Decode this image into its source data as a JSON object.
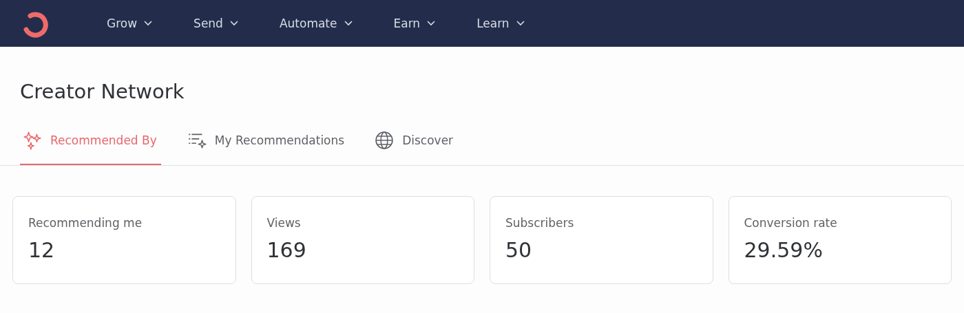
{
  "nav": {
    "items": [
      {
        "label": "Grow"
      },
      {
        "label": "Send"
      },
      {
        "label": "Automate"
      },
      {
        "label": "Earn"
      },
      {
        "label": "Learn"
      }
    ]
  },
  "page_title": "Creator Network",
  "tabs": [
    {
      "label": "Recommended By",
      "kind": "sparkles",
      "selected": true
    },
    {
      "label": "My Recommendations",
      "kind": "list",
      "selected": false
    },
    {
      "label": "Discover",
      "kind": "globe",
      "selected": false
    }
  ],
  "stats": [
    {
      "label": "Recommending me",
      "value": "12"
    },
    {
      "label": "Views",
      "value": "169"
    },
    {
      "label": "Subscribers",
      "value": "50"
    },
    {
      "label": "Conversion rate",
      "value": "29.59%"
    }
  ]
}
